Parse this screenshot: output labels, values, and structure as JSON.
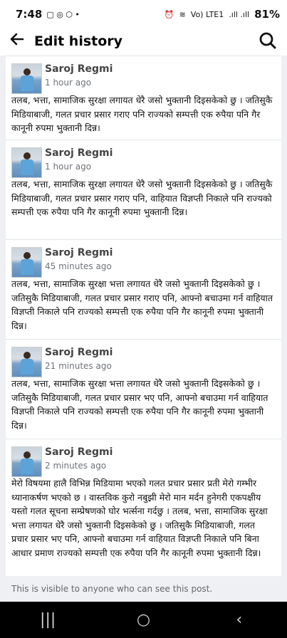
{
  "status": {
    "time": "7:48",
    "battery": "81%",
    "net": "Vo) LTE1"
  },
  "header": {
    "back_icon": "arrow-left-icon",
    "title": "Edit history",
    "search_icon": "search-icon"
  },
  "entries": [
    {
      "name": "Saroj Regmi",
      "time": "1 hour ago",
      "text": "तलब, भत्ता, सामाजिक सुरक्षा लगायत धेरै जसो भुक्तानी दिइसकेको छु । जतिसुकै मिडियाबाजी, गलत प्रचार प्रसार गराए पनि राज्यको सम्पत्ती एक रुपैया पनि गैर कानूनी रुपमा भुक्तानी दिन्न।"
    },
    {
      "name": "Saroj Regmi",
      "time": "1 hour ago",
      "text": "तलब, भत्ता, सामाजिक सुरक्षा लगायत धेरै जसो भुक्तानी दिइसकेको छु । जतिसुकै मिडियाबाजी, गलत प्रचार प्रसार गराए पनि, वाहियात विज्ञप्ती निकाले पनि राज्यको सम्पत्ती एक रुपैया पनि गैर कानूनी रुपमा भुक्तानी दिन्न।"
    },
    {
      "name": "Saroj Regmi",
      "time": "45 minutes ago",
      "text": "तलब, भत्ता, सामाजिक सुरक्षा भत्ता लगायत धेरै जसो भुक्तानी दिइसकेको छु । जतिसुकै मिडियाबाजी, गलत प्रचार प्रसार गराए पनि, आफ्नो बचाउमा गर्न वाहियात विज्ञप्ती निकाले पनि राज्यको सम्पत्ती एक रुपैया पनि गैर कानूनी रुपमा भुक्तानी दिन्न।"
    },
    {
      "name": "Saroj Regmi",
      "time": "21 minutes ago",
      "text": "तलब, भत्ता, सामाजिक सुरक्षा भत्ता लगायत धेरै जसो भुक्तानी दिइसकेको छु । जतिसुकै मिडियाबाजी, गलत प्रचार प्रसार भए पनि, आफ्नो बचाउमा गर्न वाहियात विज्ञप्ती निकाले पनि राज्यको सम्पत्ती एक रुपैया पनि गैर कानूनी रुपमा भुक्तानी दिन्न।"
    },
    {
      "name": "Saroj Regmi",
      "time": "2 minutes ago",
      "text": "मेरो विषयमा हालै विभिन्न मिडियामा भएको गलत प्रचार प्रसार प्रती मेरो गम्भीर ध्यानाकर्षण भएको छ । वास्तविक कुरो नबुझी मेरो मान मर्दन हुनेगरी एकपक्षीय यस्तो गलत सूचना सम्प्रेषणको घोर भर्त्सना गर्दछु । तलब, भत्ता, सामाजिक सुरक्षा भत्ता लगायत धेरै जसो भुक्तानी दिइसकेको छु । जतिसुकै मिडियाबाजी, गलत प्रचार प्रसार भए पनि, आफ्नो बचाउमा गर्न वाहियात विज्ञप्ती निकाले पनि बिना आधार प्रमाण राज्यको सम्पत्ती एक रुपैया पनि गैर कानूनी रुपमा भुक्तानी दिन्न।"
    }
  ],
  "footer": {
    "note": "This is visible to anyone who can see this post."
  },
  "navbar": {
    "recents": "|||",
    "home": "○",
    "back": "‹"
  }
}
